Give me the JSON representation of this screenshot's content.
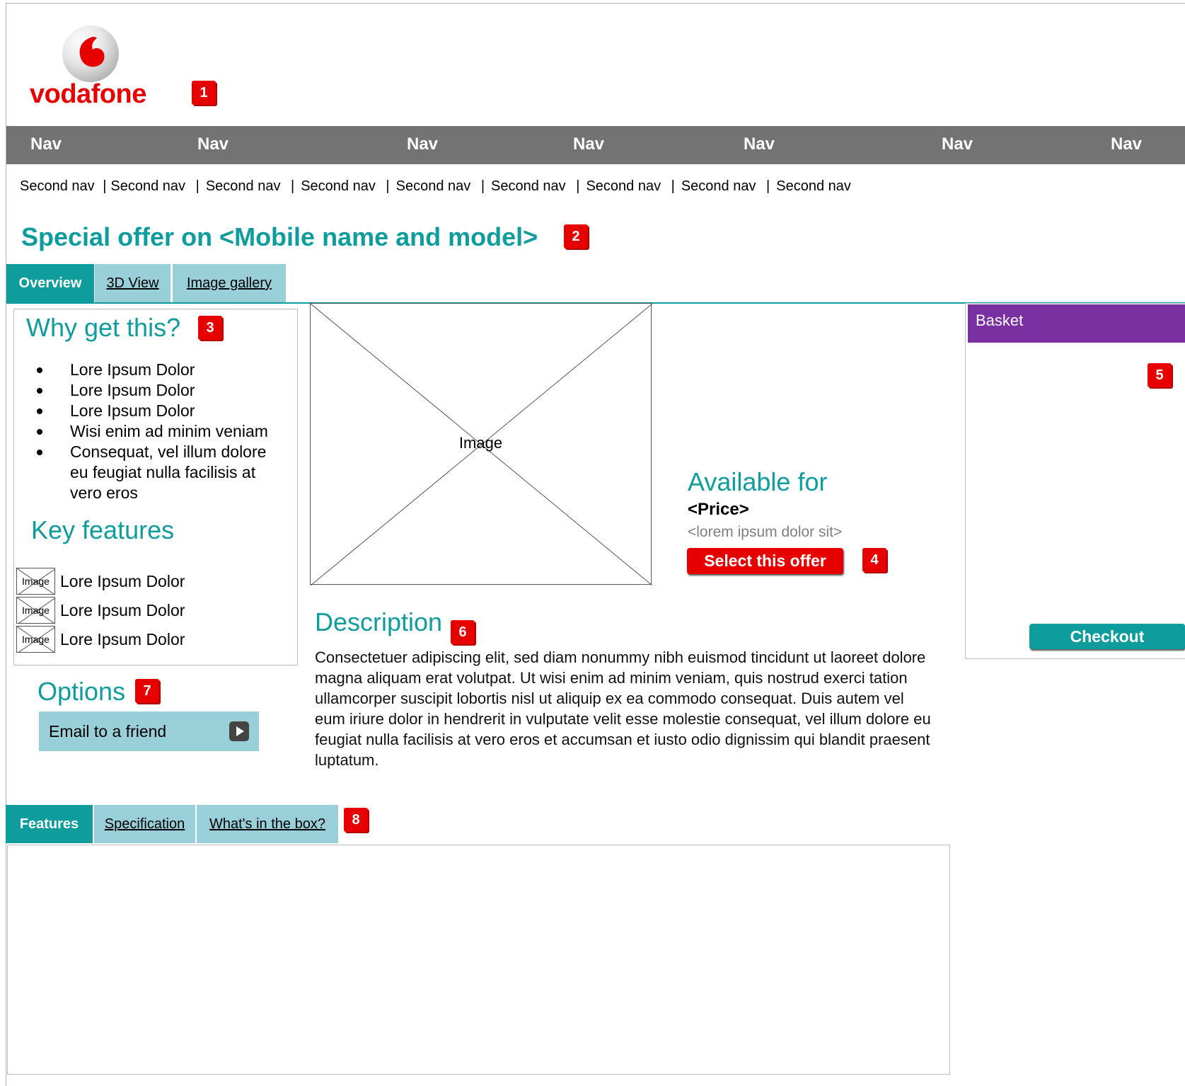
{
  "brand": {
    "name": "vodafone",
    "color": "#e60000"
  },
  "badges": {
    "b1": "1",
    "b2": "2",
    "b3": "3",
    "b4": "4",
    "b5": "5",
    "b6": "6",
    "b7": "7",
    "b8": "8"
  },
  "main_nav": {
    "items": [
      "Nav",
      "Nav",
      "Nav",
      "Nav",
      "Nav",
      "Nav",
      "Nav"
    ]
  },
  "second_nav": {
    "items": [
      "Second nav",
      "Second nav",
      "Second nav",
      "Second nav",
      "Second nav",
      "Second nav",
      "Second nav",
      "Second nav",
      "Second nav"
    ],
    "separator": "|"
  },
  "page_title": "Special offer on <Mobile name and model>",
  "product_tabs": [
    {
      "label": "Overview",
      "active": true
    },
    {
      "label": "3D View",
      "active": false
    },
    {
      "label": "Image gallery",
      "active": false
    }
  ],
  "why": {
    "heading": "Why get this?",
    "bullets": [
      "Lore Ipsum Dolor",
      "Lore Ipsum Dolor",
      "Lore Ipsum Dolor",
      "Wisi enim ad minim veniam",
      "Consequat, vel illum dolore eu feugiat nulla facilisis at vero eros"
    ]
  },
  "key_features": {
    "heading": "Key features",
    "items": [
      {
        "thumb": "Image",
        "label": "Lore Ipsum Dolor"
      },
      {
        "thumb": "Image",
        "label": "Lore Ipsum Dolor"
      },
      {
        "thumb": "Image",
        "label": "Lore Ipsum Dolor"
      }
    ]
  },
  "options": {
    "heading": "Options",
    "email_button": "Email to a friend"
  },
  "product_image": {
    "label": "Image"
  },
  "availability": {
    "heading": "Available for",
    "price": "<Price>",
    "subtext": "<lorem ipsum dolor sit>",
    "cta": "Select this offer"
  },
  "description": {
    "heading": "Description",
    "body": "Consectetuer adipiscing elit, sed diam nonummy nibh euismod tincidunt ut laoreet dolore magna aliquam erat volutpat. Ut wisi enim ad minim veniam, quis nostrud exerci tation ullamcorper suscipit lobortis nisl ut aliquip ex ea commodo consequat. Duis autem vel eum iriure dolor in hendrerit in vulputate velit esse molestie consequat, vel illum dolore eu feugiat nulla facilisis at vero eros et accumsan et iusto odio dignissim qui blandit praesent luptatum."
  },
  "basket": {
    "title": "Basket",
    "checkout": "Checkout"
  },
  "detail_tabs": [
    {
      "label": "Features",
      "active": true
    },
    {
      "label": "Specification",
      "active": false
    },
    {
      "label": "What's in the box?",
      "active": false
    }
  ],
  "colors": {
    "teal": "#0e9c9c",
    "light_blue": "#99cfd9",
    "nav_gray": "#737373",
    "basket_purple": "#7a30a0",
    "red": "#e60000"
  }
}
